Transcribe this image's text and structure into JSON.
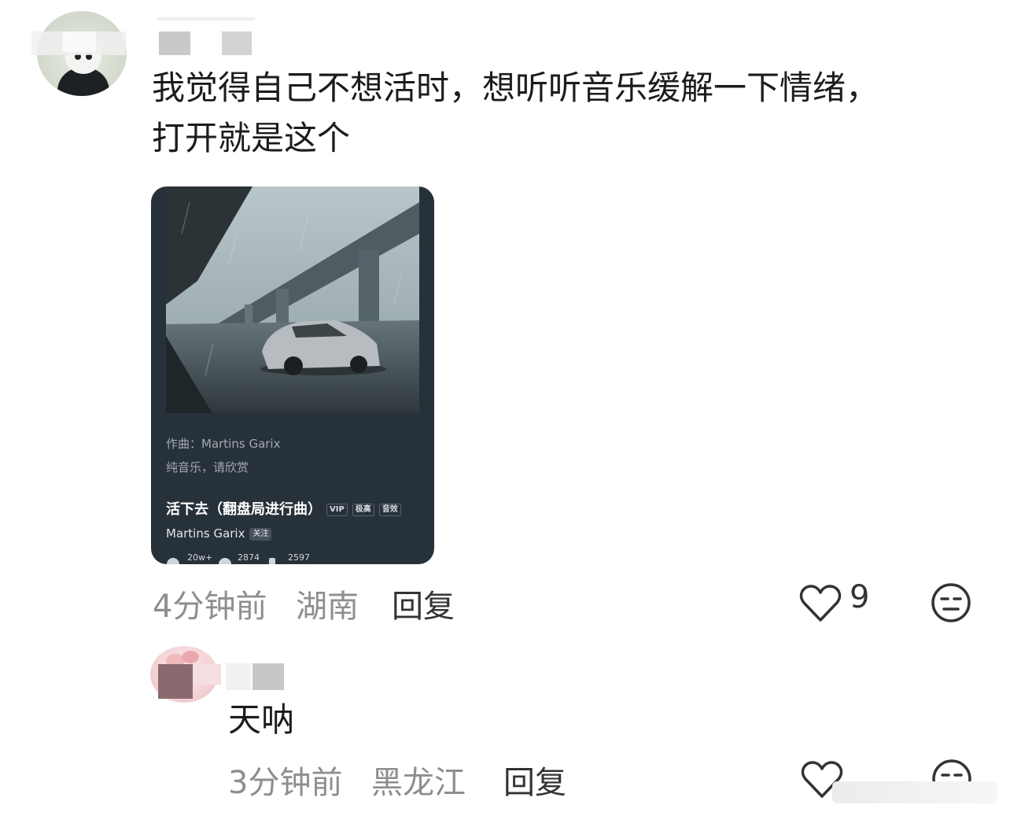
{
  "comment1": {
    "text_line1": "我觉得自己不想活时，想听听音乐缓解一下情绪，",
    "text_line2": "打开就是这个",
    "time": "4分钟前",
    "location": "湖南",
    "reply_label": "回复",
    "like_count": "9",
    "icons": [
      "heart-icon",
      "meh-face-icon"
    ]
  },
  "music_card": {
    "composer": "作曲：Martins Garix",
    "note": "纯音乐，请欣赏",
    "song_title": "活下去（翻盘局进行曲）",
    "tags": [
      "VIP",
      "极高",
      "音效"
    ],
    "artist": "Martins Garix",
    "follow_label": "关注",
    "stats": [
      "20w+",
      "2874",
      "2597"
    ]
  },
  "comment2": {
    "text": "天呐",
    "time": "3分钟前",
    "location": "黑龙江",
    "reply_label": "回复",
    "icons": [
      "heart-icon",
      "meh-face-icon"
    ]
  },
  "colors": {
    "card_bg": "#27313a",
    "meta_text": "#8e8e8e",
    "body_text": "#1c1c1c"
  }
}
